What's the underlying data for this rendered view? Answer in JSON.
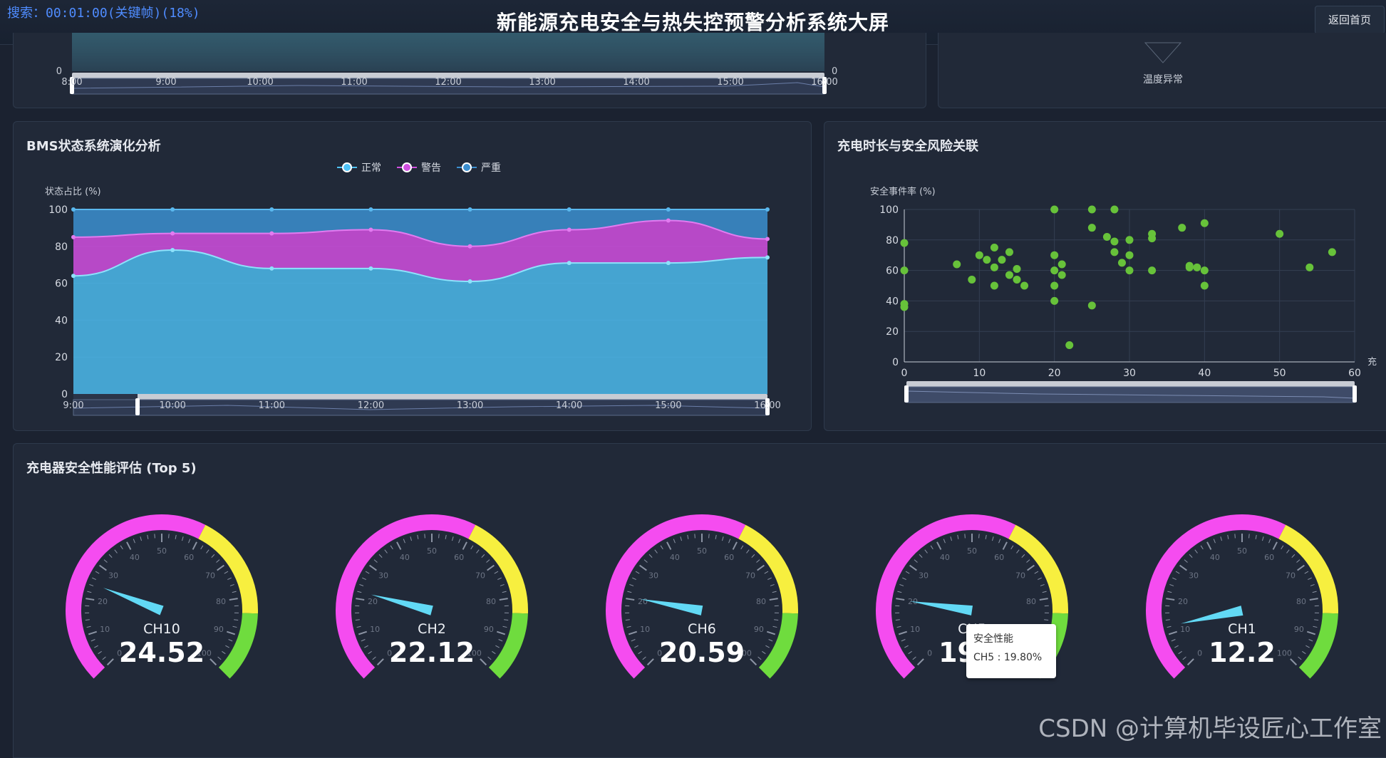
{
  "header": {
    "search_text": "搜索：00:01:00(关键帧)(18%)",
    "title": "新能源充电安全与热失控预警分析系统大屏",
    "home_button": "返回首页"
  },
  "top_partial": {
    "axis_zero_left": "0",
    "axis_zero_right": "0",
    "x_labels": [
      "8:00",
      "9:00",
      "10:00",
      "11:00",
      "12:00",
      "13:00",
      "14:00",
      "15:00",
      "16:00"
    ],
    "funnel_label": "温度异常"
  },
  "colors": {
    "normal": "#4fc3f7",
    "warning": "#d14fe0",
    "severe": "#3b8fd0",
    "scatter": "#67c23a",
    "gauge_low": "#f54cf0",
    "gauge_mid": "#f7ef3f",
    "gauge_high": "#6fdc3e",
    "pointer": "#62d9f5"
  },
  "bms_panel": {
    "title": "BMS状态系统演化分析",
    "chart_data": {
      "type": "area",
      "ylabel": "状态占比 (%)",
      "ylim": [
        0,
        100
      ],
      "y_ticks": [
        "0",
        "20",
        "40",
        "60",
        "80",
        "100"
      ],
      "categories": [
        "9:00",
        "10:00",
        "11:00",
        "12:00",
        "13:00",
        "14:00",
        "15:00",
        "16:00"
      ],
      "x_tick_labels": [
        "10:00",
        "11:00",
        "12:00",
        "13:00",
        "14:00",
        "15:00"
      ],
      "slider_labels": [
        "9:00",
        "16:00"
      ],
      "legend": [
        "正常",
        "警告",
        "严重"
      ],
      "series": [
        {
          "name": "正常",
          "values": [
            64,
            78,
            68,
            68,
            61,
            71,
            71,
            74
          ]
        },
        {
          "name": "警告",
          "values": [
            21,
            9,
            19,
            21,
            19,
            18,
            23,
            10
          ]
        },
        {
          "name": "严重",
          "values": [
            15,
            13,
            13,
            11,
            20,
            11,
            6,
            16
          ]
        }
      ]
    }
  },
  "scatter_panel": {
    "title": "充电时长与安全风险关联",
    "chart_data": {
      "type": "scatter",
      "ylabel": "安全事件率 (%)",
      "xlabel": "充",
      "xlim": [
        0,
        60
      ],
      "ylim": [
        0,
        100
      ],
      "x_ticks": [
        "0",
        "10",
        "20",
        "30",
        "40",
        "50",
        "60"
      ],
      "y_ticks": [
        "0",
        "20",
        "40",
        "60",
        "80",
        "100"
      ],
      "points": [
        [
          0,
          78
        ],
        [
          0,
          60
        ],
        [
          0,
          38
        ],
        [
          0,
          36
        ],
        [
          7,
          64
        ],
        [
          9,
          54
        ],
        [
          10,
          70
        ],
        [
          11,
          67
        ],
        [
          12,
          75
        ],
        [
          12,
          62
        ],
        [
          12,
          50
        ],
        [
          13,
          67
        ],
        [
          14,
          72
        ],
        [
          14,
          57
        ],
        [
          15,
          54
        ],
        [
          15,
          61
        ],
        [
          16,
          50
        ],
        [
          20,
          100
        ],
        [
          20,
          70
        ],
        [
          20,
          60
        ],
        [
          20,
          50
        ],
        [
          20,
          40
        ],
        [
          21,
          64
        ],
        [
          21,
          57
        ],
        [
          22,
          11
        ],
        [
          25,
          100
        ],
        [
          25,
          88
        ],
        [
          25,
          37
        ],
        [
          27,
          82
        ],
        [
          28,
          100
        ],
        [
          28,
          79
        ],
        [
          28,
          72
        ],
        [
          29,
          65
        ],
        [
          30,
          80
        ],
        [
          30,
          70
        ],
        [
          30,
          60
        ],
        [
          33,
          84
        ],
        [
          33,
          81
        ],
        [
          33,
          60
        ],
        [
          37,
          88
        ],
        [
          38,
          63
        ],
        [
          38,
          62
        ],
        [
          39,
          62
        ],
        [
          40,
          91
        ],
        [
          40,
          60
        ],
        [
          40,
          50
        ],
        [
          50,
          84
        ],
        [
          54,
          62
        ],
        [
          57,
          72
        ]
      ]
    }
  },
  "gauge_panel": {
    "title": "充电器安全性能评估 (Top 5)",
    "chart_data": {
      "type": "gauge",
      "min": 0,
      "max": 100,
      "tick_labels": [
        "0",
        "10",
        "20",
        "30",
        "40",
        "50",
        "60",
        "70",
        "80",
        "90",
        "100"
      ],
      "gauges": [
        {
          "name": "CH10",
          "value": 24.52,
          "display": "24.52"
        },
        {
          "name": "CH2",
          "value": 22.12,
          "display": "22.12"
        },
        {
          "name": "CH6",
          "value": 20.59,
          "display": "20.59"
        },
        {
          "name": "CH5",
          "value": 19.8,
          "display": "19.8"
        },
        {
          "name": "CH1",
          "value": 12.2,
          "display": "12.2"
        }
      ]
    },
    "tooltip": {
      "title": "安全性能",
      "text": "CH5 : 19.80%"
    }
  },
  "watermark": "CSDN @计算机毕设匠心工作室"
}
